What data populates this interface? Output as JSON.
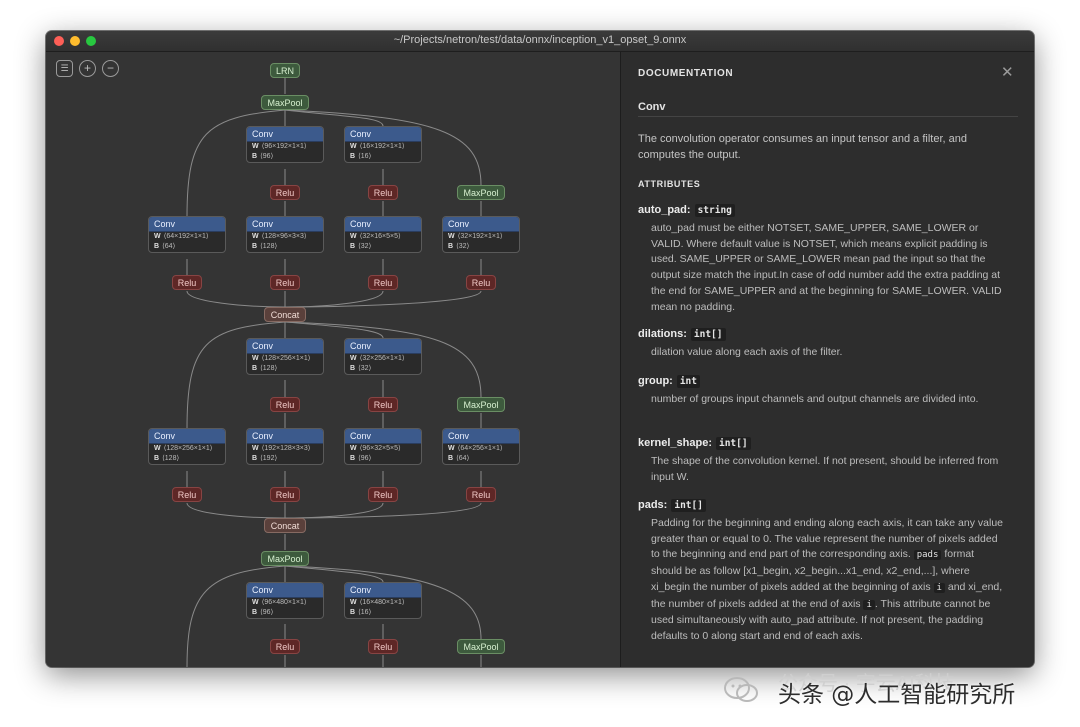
{
  "window": {
    "title": "~/Projects/netron/test/data/onnx/inception_v1_opset_9.onnx"
  },
  "toolbar": {
    "sidebar_icon": "sidebar-icon",
    "zoom_in_icon": "zoom-in-icon",
    "zoom_out_icon": "zoom-out-icon"
  },
  "graph": {
    "lrn": "LRN",
    "maxpool": "MaxPool",
    "relu": "Relu",
    "concat": "Concat",
    "conv": "Conv",
    "w": "W",
    "b": "B",
    "block1_top": [
      {
        "w": "⟨96×192×1×1⟩",
        "b": "⟨96⟩"
      },
      {
        "w": "⟨16×192×1×1⟩",
        "b": "⟨16⟩"
      }
    ],
    "block1_bottom": [
      {
        "w": "⟨64×192×1×1⟩",
        "b": "⟨64⟩"
      },
      {
        "w": "⟨128×96×3×3⟩",
        "b": "⟨128⟩"
      },
      {
        "w": "⟨32×16×5×5⟩",
        "b": "⟨32⟩"
      },
      {
        "w": "⟨32×192×1×1⟩",
        "b": "⟨32⟩"
      }
    ],
    "block2_top": [
      {
        "w": "⟨128×256×1×1⟩",
        "b": "⟨128⟩"
      },
      {
        "w": "⟨32×256×1×1⟩",
        "b": "⟨32⟩"
      }
    ],
    "block2_bottom": [
      {
        "w": "⟨128×256×1×1⟩",
        "b": "⟨128⟩"
      },
      {
        "w": "⟨192×128×3×3⟩",
        "b": "⟨192⟩"
      },
      {
        "w": "⟨96×32×5×5⟩",
        "b": "⟨96⟩"
      },
      {
        "w": "⟨64×256×1×1⟩",
        "b": "⟨64⟩"
      }
    ],
    "block3_top": [
      {
        "w": "⟨96×480×1×1⟩",
        "b": "⟨96⟩"
      },
      {
        "w": "⟨16×480×1×1⟩",
        "b": "⟨16⟩"
      }
    ]
  },
  "documentation": {
    "heading": "DOCUMENTATION",
    "close_icon": "close-icon",
    "operator": "Conv",
    "description": "The convolution operator consumes an input tensor and a filter, and computes the output.",
    "attributes_heading": "ATTRIBUTES",
    "attributes": [
      {
        "name": "auto_pad:",
        "type": "string",
        "desc": "auto_pad must be either NOTSET, SAME_UPPER, SAME_LOWER or VALID. Where default value is NOTSET, which means explicit padding is used. SAME_UPPER or SAME_LOWER mean pad the input so that the output size match the input.In case of odd number add the extra padding at the end for SAME_UPPER and at the beginning for SAME_LOWER. VALID mean no padding."
      },
      {
        "name": "dilations:",
        "type": "int[]",
        "desc": "dilation value along each axis of the filter."
      },
      {
        "name": "group:",
        "type": "int",
        "desc": "number of groups input channels and output channels are divided into."
      },
      {
        "name": "kernel_shape:",
        "type": "int[]",
        "desc": "The shape of the convolution kernel. If not present, should be inferred from input W."
      },
      {
        "name": "pads:",
        "type": "int[]",
        "desc_1": "Padding for the beginning and ending along each axis, it can take any value greater than or equal to 0. The value represent the number of pixels added to the beginning and end part of the corresponding axis.",
        "code_pads": "pads",
        "desc_2": "format should be as follow [x1_begin, x2_begin...x1_end, x2_end,...], where xi_begin the number of pixels added at the beginning of axis",
        "code_i": "i",
        "desc_3": "and xi_end, the number of pixels added at the end of axis",
        "desc_4": ". This attribute cannot be used simultaneously with auto_pad attribute. If not present, the padding defaults to 0 along start and end of each axis."
      }
    ]
  },
  "watermark": {
    "faint": "公众号 · 宇云AI科技",
    "text": "头条 @人工智能研究所"
  },
  "colors": {
    "conv_header": "#3c5a8c",
    "relu": "#5e2726",
    "maxpool": "#3d5a3d",
    "concat": "#5a403b",
    "panel": "#2d2d2d"
  }
}
